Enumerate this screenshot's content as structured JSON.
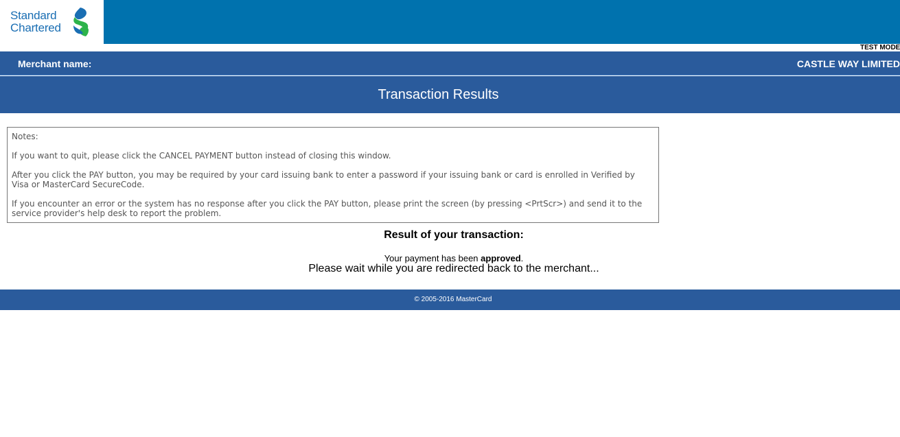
{
  "brand": {
    "line1": "Standard",
    "line2": "Chartered",
    "logo_icon": "standard-chartered-swirl-icon",
    "colors": {
      "blue": "#1a6eb3",
      "green": "#2db34a",
      "header": "#0072ae",
      "bar": "#2a5b9c"
    }
  },
  "test_mode": "TEST MODE",
  "merchant": {
    "label": "Merchant name:",
    "value": "CASTLE WAY LIMITED"
  },
  "page_title": "Transaction Results",
  "notes": {
    "heading": "Notes:",
    "items": [
      "If you want to quit, please click the CANCEL PAYMENT button instead of closing this window.",
      "After you click the PAY button, you may be required by your card issuing bank to enter a password if your issuing bank or card is enrolled in Verified by Visa or MasterCard SecureCode.",
      "If you encounter an error or the system has no response after you click the PAY button, please print the screen (by pressing <PrtScr>) and send it to the service provider's help desk to report the problem."
    ]
  },
  "result": {
    "heading": "Result of your transaction:",
    "prefix": "Your payment has been ",
    "status": "approved",
    "suffix": ".",
    "redirect": "Please wait while you are redirected back to the merchant..."
  },
  "footer": {
    "copyright": "© 2005-2016 MasterCard"
  }
}
